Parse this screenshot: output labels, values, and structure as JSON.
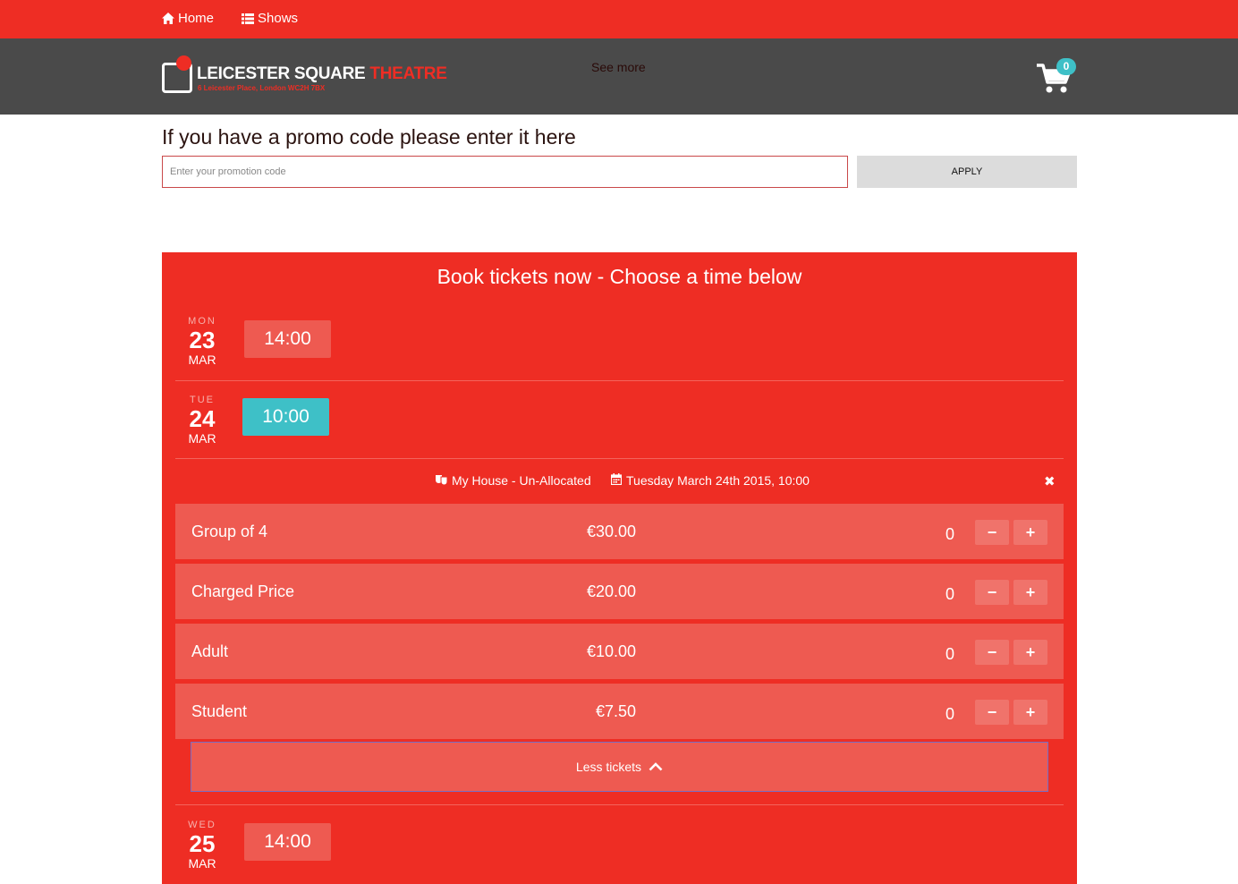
{
  "topnav": {
    "home_label": "Home",
    "shows_label": "Shows",
    "home_icon": "home-icon",
    "shows_icon": "list-icon"
  },
  "header": {
    "logo_name_white": "LEICESTER SQUARE",
    "logo_name_red": "THEATRE",
    "logo_address": "6 Leicester Place, London WC2H 7BX",
    "see_more": "See more",
    "cart_count": "0"
  },
  "promo": {
    "heading": "If you have a promo code please enter it here",
    "placeholder": "Enter your promotion code",
    "value": "",
    "apply_label": "APPLY"
  },
  "booking": {
    "title": "Book tickets now - Choose a time below",
    "days": [
      {
        "dow": "MON",
        "day": "23",
        "month": "MAR",
        "time": "14:00",
        "selected": false
      },
      {
        "dow": "TUE",
        "day": "24",
        "month": "MAR",
        "time": "10:00",
        "selected": true
      },
      {
        "dow": "WED",
        "day": "25",
        "month": "MAR",
        "time": "14:00",
        "selected": false
      }
    ],
    "performance": {
      "venue": "My House - Un-Allocated",
      "datetime": "Tuesday March 24th 2015, 10:00"
    },
    "tickets": [
      {
        "name": "Group of 4",
        "price": "€30.00",
        "qty": "0"
      },
      {
        "name": "Charged Price",
        "price": "€20.00",
        "qty": "0"
      },
      {
        "name": "Adult",
        "price": "€10.00",
        "qty": "0"
      },
      {
        "name": "Student",
        "price": "€7.50",
        "qty": "0"
      }
    ],
    "less_tickets_label": "Less tickets"
  },
  "colors": {
    "brand_red": "#ee2d24",
    "header_grey": "#4a4a4a",
    "accent_teal": "#3ec0c7",
    "row_red": "#ee5a51"
  }
}
